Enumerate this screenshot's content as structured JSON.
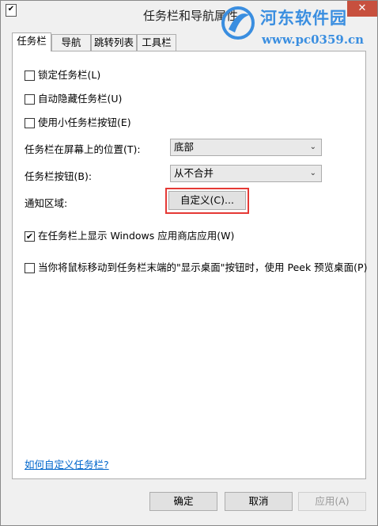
{
  "window": {
    "title": "任务栏和导航属性",
    "close_label": "✕"
  },
  "watermark": {
    "title": "河东软件园",
    "url": "www.pc0359.cn",
    "brand_color": "#3a8ee0"
  },
  "tabs": [
    {
      "label": "任务栏",
      "active": true
    },
    {
      "label": "导航",
      "active": false
    },
    {
      "label": "跳转列表",
      "active": false
    },
    {
      "label": "工具栏",
      "active": false
    }
  ],
  "options": {
    "lock_taskbar": {
      "label": "锁定任务栏(L)",
      "checked": false
    },
    "auto_hide": {
      "label": "自动隐藏任务栏(U)",
      "checked": false
    },
    "small_buttons": {
      "label": "使用小任务栏按钮(E)",
      "checked": false
    },
    "show_store_apps": {
      "label": "在任务栏上显示 Windows 应用商店应用(W)",
      "checked": true
    },
    "peek": {
      "label": "当你将鼠标移动到任务栏末端的\"显示桌面\"按钮时，使用 Peek 预览桌面(P)",
      "checked": false
    }
  },
  "position": {
    "label": "任务栏在屏幕上的位置(T):",
    "value": "底部"
  },
  "buttons_combine": {
    "label": "任务栏按钮(B):",
    "value": "从不合并"
  },
  "notification_area": {
    "label": "通知区域:",
    "customize_label": "自定义(C)...",
    "highlight_color": "#e53935"
  },
  "help_link": "如何自定义任务栏?",
  "footer": {
    "ok_label": "确定",
    "cancel_label": "取消",
    "apply_label": "应用(A)"
  },
  "check_mark": "✔",
  "chevron": "⌄"
}
